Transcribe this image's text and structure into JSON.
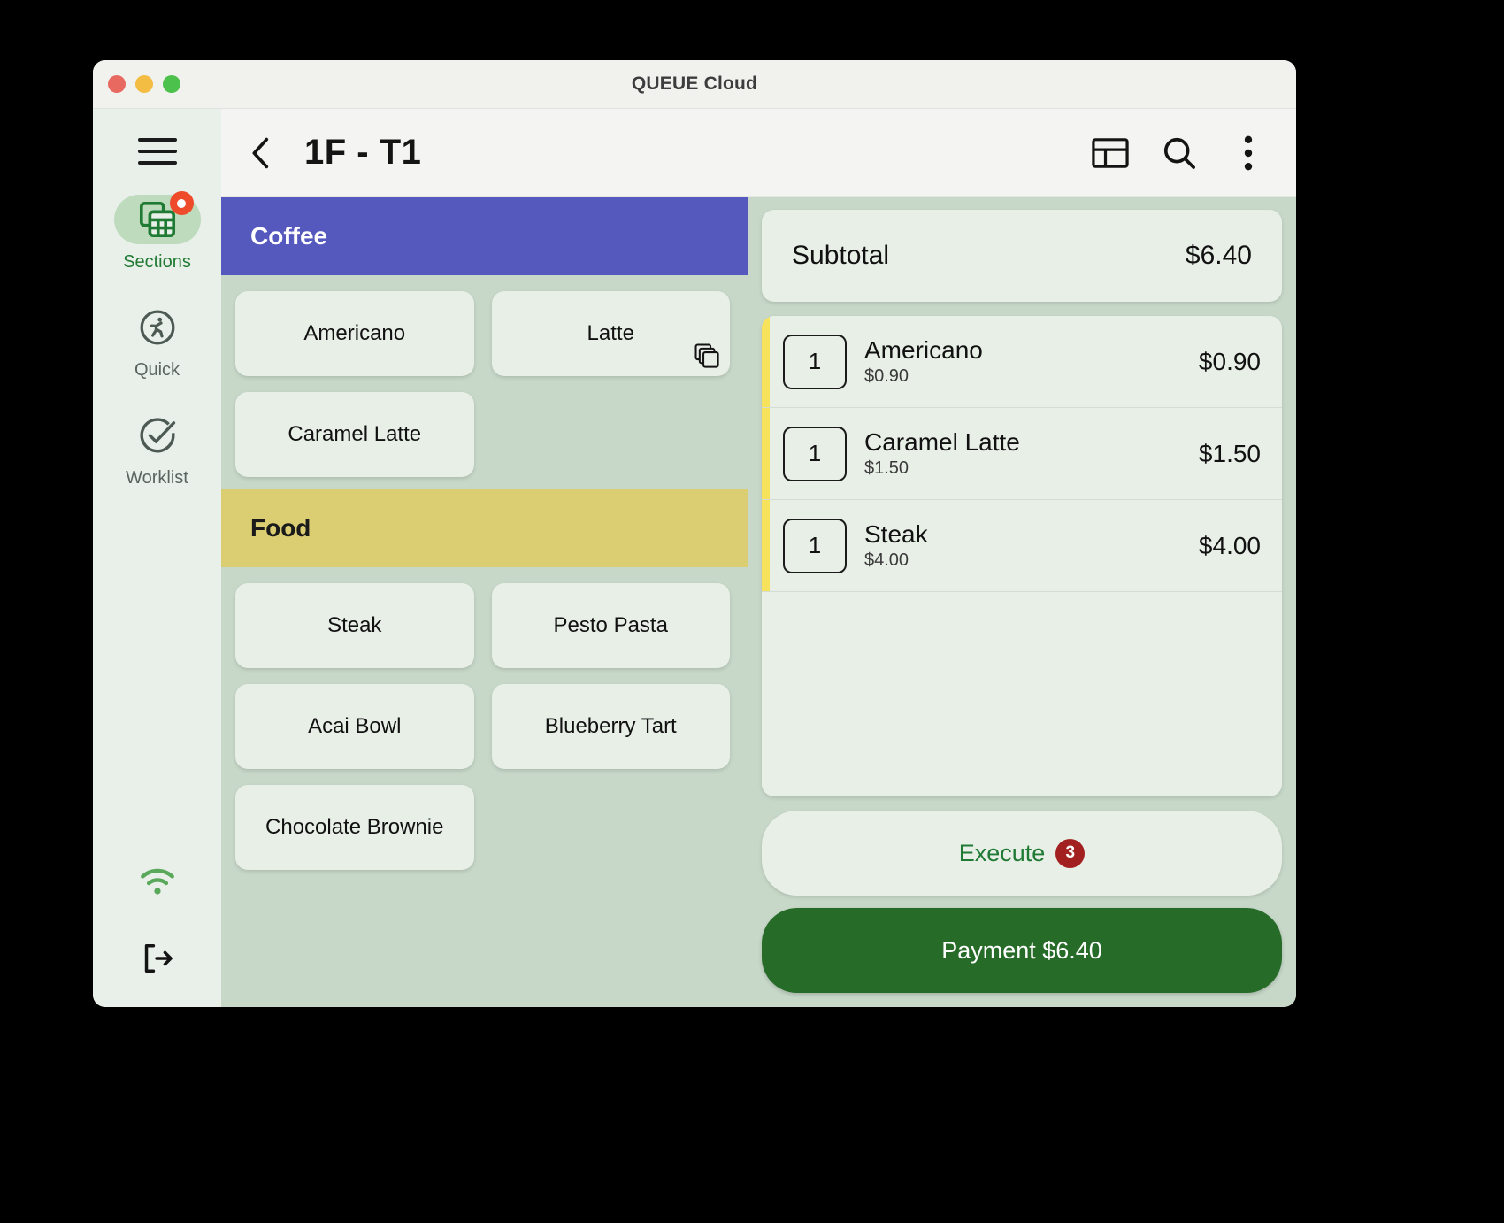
{
  "window": {
    "title": "QUEUE Cloud",
    "traffic_lights": [
      "close",
      "minimize",
      "zoom"
    ]
  },
  "sidebar": {
    "menu_icon": "hamburger-icon",
    "items": [
      {
        "label": "Sections",
        "icon": "sections-grid-icon",
        "active": true,
        "badge": true
      },
      {
        "label": "Quick",
        "icon": "running-person-icon",
        "active": false,
        "badge": false
      },
      {
        "label": "Worklist",
        "icon": "check-circle-icon",
        "active": false,
        "badge": false
      }
    ],
    "bottom": [
      {
        "icon": "wifi-icon",
        "color": "#5aa85a"
      },
      {
        "icon": "logout-icon",
        "color": "#1b1b1b"
      }
    ]
  },
  "header": {
    "back_icon": "chevron-left-icon",
    "title": "1F - T1",
    "actions": [
      {
        "icon": "layout-split-icon"
      },
      {
        "icon": "search-icon"
      },
      {
        "icon": "more-vertical-icon"
      }
    ]
  },
  "catalog": {
    "categories": [
      {
        "name": "Coffee",
        "header_bg": "#5558bd",
        "header_fg": "#ffffff",
        "items": [
          {
            "label": "Americano",
            "has_variants": false
          },
          {
            "label": "Latte",
            "has_variants": true
          },
          {
            "label": "Caramel Latte",
            "has_variants": false
          }
        ]
      },
      {
        "name": "Food",
        "header_bg": "#dacd72",
        "header_fg": "#1a1a1a",
        "items": [
          {
            "label": "Steak",
            "has_variants": false
          },
          {
            "label": "Pesto Pasta",
            "has_variants": false
          },
          {
            "label": "Acai Bowl",
            "has_variants": false
          },
          {
            "label": "Blueberry Tart",
            "has_variants": false
          },
          {
            "label": "Chocolate Brownie",
            "has_variants": false
          }
        ]
      }
    ]
  },
  "order": {
    "subtotal_label": "Subtotal",
    "subtotal_value": "$6.40",
    "accent_color": "#f7e25c",
    "items": [
      {
        "qty": "1",
        "name": "Americano",
        "unit_price": "$0.90",
        "line_total": "$0.90"
      },
      {
        "qty": "1",
        "name": "Caramel Latte",
        "unit_price": "$1.50",
        "line_total": "$1.50"
      },
      {
        "qty": "1",
        "name": "Steak",
        "unit_price": "$4.00",
        "line_total": "$4.00"
      }
    ],
    "execute_label": "Execute",
    "execute_badge": "3",
    "payment_label": "Payment $6.40"
  }
}
